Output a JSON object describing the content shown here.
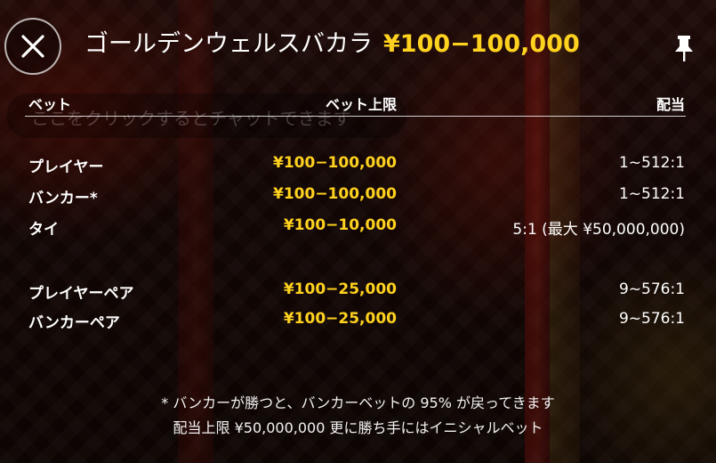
{
  "header": {
    "close_icon": "close-icon",
    "title": "ゴールデンウェルスバカラ",
    "limit": "¥100−100,000",
    "pin_icon": "pin-icon"
  },
  "chat": {
    "placeholder": "ここをクリックするとチャットできます"
  },
  "table": {
    "columns": [
      "ベット",
      "ベット上限",
      "配当"
    ],
    "rows": [
      {
        "bet": "プレイヤー",
        "limit": "¥100−100,000",
        "payout": "1~512:1"
      },
      {
        "bet": "バンカー*",
        "limit": "¥100−100,000",
        "payout": "1~512:1"
      },
      {
        "bet": "タイ",
        "limit": "¥100−10,000",
        "payout": "5:1 (最大 ¥50,000,000)"
      },
      {
        "bet": "プレイヤーペア",
        "limit": "¥100−25,000",
        "payout": "9~576:1"
      },
      {
        "bet": "バンカーペア",
        "limit": "¥100−25,000",
        "payout": "9~576:1"
      }
    ]
  },
  "footnotes": [
    "* バンカーが勝つと、バンカーベットの 95% が戻ってきます",
    "配当上限 ¥50,000,000 更に勝ち手にはイニシャルベット"
  ],
  "colors": {
    "accent_yellow": "#ffd21f",
    "text_white": "#ffffff"
  }
}
